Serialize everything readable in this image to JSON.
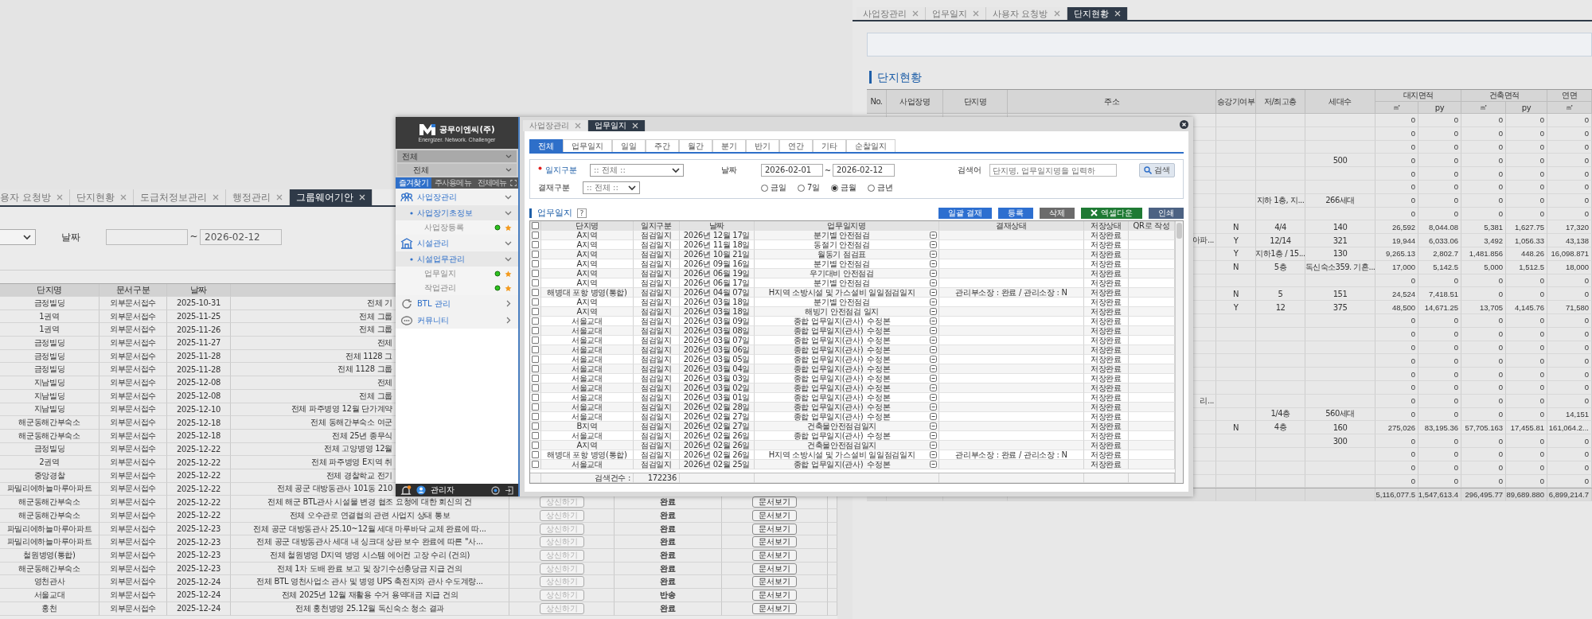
{
  "left_window": {
    "tabs": [
      {
        "label": "용자 요청방",
        "selected": false
      },
      {
        "label": "단지현황",
        "selected": false
      },
      {
        "label": "도급처정보관리",
        "selected": false
      },
      {
        "label": "행정관리",
        "selected": false
      },
      {
        "label": "그룹웨어기안",
        "selected": true
      }
    ],
    "filter": {
      "date_label": "날짜",
      "range_separator": "~",
      "date_to": "2026-02-12"
    },
    "table": {
      "columns": [
        "단지명",
        "문서구분",
        "날짜"
      ],
      "rows": [
        {
          "site": "금정빌딩",
          "doc_type": "외부문서접수",
          "date": "2025-10-31",
          "title": "전체 기"
        },
        {
          "site": "1권역",
          "doc_type": "외부문서접수",
          "date": "2025-11-25",
          "title": "전체 그룹"
        },
        {
          "site": "1권역",
          "doc_type": "외부문서접수",
          "date": "2025-11-26",
          "title": "전체 그룹"
        },
        {
          "site": "금정빌딩",
          "doc_type": "외부문서접수",
          "date": "2025-11-27",
          "title": "전체"
        },
        {
          "site": "금정빌딩",
          "doc_type": "외부문서접수",
          "date": "2025-11-28",
          "title": "전체 1128 그"
        },
        {
          "site": "금정빌딩",
          "doc_type": "외부문서접수",
          "date": "2025-11-28",
          "title": "전체 1128 그룹"
        },
        {
          "site": "지남빌딩",
          "doc_type": "외부문서접수",
          "date": "2025-12-08",
          "title": "전체"
        },
        {
          "site": "지남빌딩",
          "doc_type": "외부문서접수",
          "date": "2025-12-08",
          "title": "전체 그룹"
        },
        {
          "site": "지남빌딩",
          "doc_type": "외부문서접수",
          "date": "2025-12-10",
          "title": "전체 파주병영 12월 단가계약"
        },
        {
          "site": "해군동해간부숙소",
          "doc_type": "외부문서접수",
          "date": "2025-12-18",
          "title": "전체 동해간부숙소 여군"
        },
        {
          "site": "해군동해간부숙소",
          "doc_type": "외부문서접수",
          "date": "2025-12-18",
          "title": "전체 25년 종무식"
        },
        {
          "site": "금정빌딩",
          "doc_type": "외부문서접수",
          "date": "2025-12-22",
          "title": "전체 고양병영 12월"
        },
        {
          "site": "2권역",
          "doc_type": "외부문서접수",
          "date": "2025-12-22",
          "title": "전체 파주병영 E지역 취"
        },
        {
          "site": "중앙경찰",
          "doc_type": "외부문서접수",
          "date": "2025-12-22",
          "title": "전체 경찰학교 전기"
        },
        {
          "site": "파밀리에하늘마루아파트",
          "doc_type": "외부문서접수",
          "date": "2025-12-22",
          "title": "전체 공군 대방동관사 101동 210"
        },
        {
          "site": "해군동해간부숙소",
          "doc_type": "외부문서접수",
          "date": "2025-12-22",
          "title": "전체 해군 BTL관사 시설물 변경 협조 요청에 대한 회신의 건",
          "approve": {
            "label": "상신하기",
            "disabled": true
          },
          "status": "완료",
          "view_button": "문서보기"
        },
        {
          "site": "해군동해간부숙소",
          "doc_type": "외부문서접수",
          "date": "2025-12-22",
          "title": "전체 오수관로 연결협의 관련 사업지 상태 통보",
          "approve": {
            "label": "상신하기",
            "disabled": true
          },
          "status": "완료",
          "view_button": "문서보기"
        },
        {
          "site": "파밀리에하늘마루아파트",
          "doc_type": "외부문서접수",
          "date": "2025-12-23",
          "title": "전체 공군 대방동관사 25.10~12월 세대 마루바닥 교체 완료에 따...",
          "approve": {
            "label": "상신하기",
            "disabled": true
          },
          "status": "완료",
          "view_button": "문서보기"
        },
        {
          "site": "파밀리에하늘마루아파트",
          "doc_type": "외부문서접수",
          "date": "2025-12-23",
          "title": "전체 공군 대방동관사 세대 내 싱크대 상판 보수 완료에 따른 \"사...",
          "approve": {
            "label": "상신하기",
            "disabled": true
          },
          "status": "완료",
          "view_button": "문서보기"
        },
        {
          "site": "철원병영(통합)",
          "doc_type": "외부문서접수",
          "date": "2025-12-23",
          "title": "전체 철원병영 D지역 병영 시스템 에어컨 고장 수리 (건의)",
          "approve": {
            "label": "상신하기",
            "disabled": true
          },
          "status": "완료",
          "view_button": "문서보기"
        },
        {
          "site": "해군동해간부숙소",
          "doc_type": "외부문서접수",
          "date": "2025-12-23",
          "title": "전체 1차 도배 완료 보고 및 장기수선충당금 지급 건의",
          "approve": {
            "label": "상신하기",
            "disabled": true
          },
          "status": "완료",
          "view_button": "문서보기"
        },
        {
          "site": "영천관사",
          "doc_type": "외부문서접수",
          "date": "2025-12-24",
          "title": "전체 BTL 영천사업소 관사 및 병영 UPS 축전지와 관사 수도계량...",
          "approve": {
            "label": "상신하기",
            "disabled": true
          },
          "status": "완료",
          "view_button": "문서보기"
        },
        {
          "site": "서울교대",
          "doc_type": "외부문서접수",
          "date": "2025-12-24",
          "title": "전체 2025년 12월 재활용 수거 용역대금 지급 건의",
          "approve": {
            "label": "상신하기",
            "disabled": true
          },
          "status": "반송",
          "view_button": "문서보기"
        },
        {
          "site": "홍천",
          "doc_type": "외부문서접수",
          "date": "2025-12-24",
          "title": "전체 홍천병영 25.12월 독신숙소 청소 결과",
          "approve": {
            "label": "상신하기",
            "disabled": true
          },
          "status": "완료",
          "view_button": "문서보기"
        }
      ]
    }
  },
  "right_window": {
    "tabs": [
      {
        "label": "사업장관리",
        "selected": false
      },
      {
        "label": "업무일지",
        "selected": false
      },
      {
        "label": "사용자 요청방",
        "selected": false
      },
      {
        "label": "단지현황",
        "selected": true
      }
    ],
    "title": "단지현황",
    "table": {
      "columns": [
        {
          "label": "No."
        },
        {
          "label": "사업장명"
        },
        {
          "label": "단지명"
        },
        {
          "label": "주소"
        },
        {
          "label": "승강기여부"
        },
        {
          "label": "저/최고층"
        },
        {
          "label": "세대수"
        },
        {
          "label": "대지면적",
          "sub": [
            "㎡",
            "py"
          ]
        },
        {
          "label": "건축면적",
          "sub": [
            "㎡",
            "py"
          ]
        },
        {
          "label": "연면",
          "sub": [
            "㎡"
          ]
        }
      ],
      "rows": [
        {
          "areas": [
            "0",
            "0",
            "0",
            "0",
            "0"
          ]
        },
        {
          "areas": [
            "0",
            "0",
            "0",
            "0",
            "0"
          ]
        },
        {
          "areas": [
            "0",
            "0",
            "0",
            "0",
            "0"
          ]
        },
        {
          "households": "500",
          "areas": [
            "0",
            "0",
            "0",
            "0",
            "0"
          ]
        },
        {
          "areas": [
            "0",
            "0",
            "0",
            "0",
            "0"
          ]
        },
        {
          "areas": [
            "0",
            "0",
            "0",
            "0",
            "0"
          ]
        },
        {
          "floors": "지하 1층, 지...",
          "households": "266세대",
          "areas": [
            "0",
            "0",
            "0",
            "0",
            "0"
          ]
        },
        {
          "areas": [
            "0",
            "0",
            "0",
            "0",
            "0"
          ]
        },
        {
          "elevator": "N",
          "floors": "4/4",
          "households": "140",
          "areas": [
            "26,592",
            "8,044.08",
            "5,381",
            "1,627.75",
            "17,320"
          ]
        },
        {
          "address": "아파...",
          "elevator": "Y",
          "floors": "12/14",
          "households": "321",
          "areas": [
            "19,944",
            "6,033.06",
            "3,492",
            "1,056.33",
            "43,138"
          ]
        },
        {
          "elevator": "Y",
          "floors": "지하1층 / 15...",
          "households": "130",
          "areas": [
            "9,265.13",
            "2,802.7",
            "1,481.856",
            "448.26",
            "16,098.871"
          ]
        },
        {
          "elevator": "N",
          "floors": "5층",
          "households": "독신숙소359. 기혼...",
          "areas": [
            "17,000",
            "5,142.5",
            "5,000",
            "1,512.5",
            "18,000"
          ]
        },
        {
          "areas": [
            "0",
            "0",
            "0",
            "0",
            "0"
          ]
        },
        {
          "elevator": "N",
          "floors": "5",
          "households": "151",
          "areas": [
            "24,524",
            "7,418.51",
            "0",
            "0",
            "0"
          ]
        },
        {
          "elevator": "Y",
          "floors": "12",
          "households": "375",
          "areas": [
            "48,500",
            "14,671.25",
            "13,705",
            "4,145.76",
            "71,580"
          ]
        },
        {
          "areas": [
            "0",
            "0",
            "0",
            "0",
            "0"
          ]
        },
        {
          "areas": [
            "0",
            "0",
            "0",
            "0",
            "0"
          ]
        },
        {
          "areas": [
            "0",
            "0",
            "0",
            "0",
            "0"
          ]
        },
        {
          "areas": [
            "0",
            "0",
            "0",
            "0",
            "0"
          ]
        },
        {
          "areas": [
            "0",
            "0",
            "0",
            "0",
            "0"
          ]
        },
        {
          "areas": [
            "0",
            "0",
            "0",
            "0",
            "0"
          ]
        },
        {
          "address": "리...",
          "areas": [
            "0",
            "0",
            "0",
            "0",
            "0"
          ]
        },
        {
          "floors": "1/4층",
          "households": "560세대",
          "areas": [
            "0",
            "0",
            "0",
            "0",
            "14,151"
          ]
        },
        {
          "elevator": "N",
          "floors": "4층",
          "households": "160",
          "areas": [
            "275,026",
            "83,195.36",
            "57,705.163",
            "17,455.81",
            "161,064.2..."
          ]
        },
        {
          "households": "300",
          "areas": [
            "0",
            "0",
            "0",
            "0",
            "0"
          ]
        },
        {
          "areas": [
            "0",
            "0",
            "0",
            "0",
            "0"
          ]
        },
        {
          "areas": [
            "0",
            "0",
            "0",
            "0",
            "0"
          ]
        },
        {
          "areas": [
            "0",
            "0",
            "0",
            "0",
            "0"
          ]
        }
      ],
      "totals": [
        "5,116,077.5",
        "1,547,613.4",
        "296,495.77",
        "89,689.880",
        "6,899,214.7"
      ]
    }
  },
  "center_window": {
    "sidebar": {
      "company": "공무이엔씨(주)",
      "slogan": "Energizer. Network. Challenger",
      "selects": [
        "전체",
        "전체"
      ],
      "menu_tabs": [
        {
          "label": "즐겨찾기",
          "selected": true
        },
        {
          "label": "주사용메뉴",
          "selected": false
        },
        {
          "label": "전체메뉴",
          "selected": false
        }
      ],
      "menu": [
        {
          "label": "사업장관리",
          "expanded": true,
          "children": [
            {
              "label": "사업장기초정보",
              "expanded": true,
              "children": [
                {
                  "label": "사업장등록"
                }
              ]
            }
          ]
        },
        {
          "label": "시설관리",
          "expanded": true,
          "children": [
            {
              "label": "시설업무관리",
              "expanded": true,
              "children": [
                {
                  "label": "업무일지"
                },
                {
                  "label": "작업관리"
                }
              ]
            }
          ]
        },
        {
          "label": "BTL 관리",
          "expanded": false
        },
        {
          "label": "커뮤니티",
          "expanded": false
        }
      ],
      "user": "관리자"
    },
    "tabs": [
      {
        "label": "사업장관리",
        "selected": false
      },
      {
        "label": "업무일지",
        "selected": true
      }
    ],
    "log_tabs": [
      {
        "label": "전체",
        "selected": true
      },
      {
        "label": "업무일지",
        "selected": false
      },
      {
        "label": "일일",
        "selected": false
      },
      {
        "label": "주간",
        "selected": false
      },
      {
        "label": "월간",
        "selected": false
      },
      {
        "label": "분기",
        "selected": false
      },
      {
        "label": "반기",
        "selected": false
      },
      {
        "label": "연간",
        "selected": false
      },
      {
        "label": "기타",
        "selected": false
      },
      {
        "label": "순찰일지",
        "selected": false
      }
    ],
    "filter": {
      "type_label": "일지구분",
      "required": true,
      "type_value": ":: 전체 ::",
      "date_label": "날짜",
      "date_from": "2026-02-01",
      "range_separator": "~",
      "date_to": "2026-02-12",
      "keyword_label": "검색어",
      "keyword_placeholder": "단지명, 업무일지명을 입력하",
      "search_button": "검색",
      "approval_label": "결재구분",
      "approval_value": ":: 전체 ::",
      "periods": [
        {
          "label": "금일",
          "selected": false
        },
        {
          "label": "7일",
          "selected": false
        },
        {
          "label": "금월",
          "selected": true
        },
        {
          "label": "금년",
          "selected": false
        }
      ]
    },
    "section_title": "업무일지",
    "help": "?",
    "buttons": [
      {
        "label": "일괄 결재",
        "kind": "primary"
      },
      {
        "label": "등록",
        "kind": "primary"
      },
      {
        "label": "삭제",
        "kind": "neutral"
      },
      {
        "label": "엑셀다운",
        "kind": "excel"
      },
      {
        "label": "인쇄",
        "kind": "print"
      }
    ],
    "table": {
      "all_checked": false,
      "columns": [
        "단지명",
        "일지구분",
        "날짜",
        "업무일지명",
        "결재상태",
        "저장상태",
        "QR로 작성"
      ],
      "rows": [
        {
          "checked": false,
          "site": "A지역",
          "type": "점검일지",
          "date": "2026년 12월 17일",
          "name": "분기별 안전점검",
          "save": "저장완료"
        },
        {
          "checked": false,
          "site": "A지역",
          "type": "점검일지",
          "date": "2026년 11월 18일",
          "name": "동절기 안전점검",
          "save": "저장완료"
        },
        {
          "checked": false,
          "site": "A지역",
          "type": "점검일지",
          "date": "2026년 10월 21일",
          "name": "월동기 점검표",
          "save": "저장완료"
        },
        {
          "checked": false,
          "site": "A지역",
          "type": "점검일지",
          "date": "2026년 09월 16일",
          "name": "분기별 안전점검",
          "save": "저장완료"
        },
        {
          "checked": false,
          "site": "A지역",
          "type": "점검일지",
          "date": "2026년 06월 19일",
          "name": "우기대비 안전점검",
          "save": "저장완료"
        },
        {
          "checked": false,
          "site": "A지역",
          "type": "점검일지",
          "date": "2026년 06월 17일",
          "name": "분기별 안전점검",
          "save": "저장완료"
        },
        {
          "checked": false,
          "site": "해병대 포항 병영(통합)",
          "type": "점검일지",
          "date": "2026년 04월 07일",
          "name": "H지역 소방시설 및 가스설비 일일점검일지",
          "approval": "관리부소장 : 완료 / 관리소장 : N",
          "save": "저장완료"
        },
        {
          "checked": false,
          "site": "A지역",
          "type": "점검일지",
          "date": "2026년 03월 18일",
          "name": "분기별 안전점검",
          "save": "저장완료"
        },
        {
          "checked": false,
          "site": "A지역",
          "type": "점검일지",
          "date": "2026년 03월 18일",
          "name": "해빙기 안전점검 일지",
          "save": "저장완료"
        },
        {
          "checked": false,
          "site": "서울교대",
          "type": "점검일지",
          "date": "2026년 03월 09일",
          "name": "종합 업무일지(관사)_수정본",
          "save": "저장완료"
        },
        {
          "checked": false,
          "site": "서울교대",
          "type": "점검일지",
          "date": "2026년 03월 08일",
          "name": "종합 업무일지(관사)_수정본",
          "save": "저장완료"
        },
        {
          "checked": false,
          "site": "서울교대",
          "type": "점검일지",
          "date": "2026년 03월 07일",
          "name": "종합 업무일지(관사)_수정본",
          "save": "저장완료"
        },
        {
          "checked": false,
          "site": "서울교대",
          "type": "점검일지",
          "date": "2026년 03월 06일",
          "name": "종합 업무일지(관사)_수정본",
          "save": "저장완료"
        },
        {
          "checked": false,
          "site": "서울교대",
          "type": "점검일지",
          "date": "2026년 03월 05일",
          "name": "종합 업무일지(관사)_수정본",
          "save": "저장완료"
        },
        {
          "checked": false,
          "site": "서울교대",
          "type": "점검일지",
          "date": "2026년 03월 04일",
          "name": "종합 업무일지(관사)_수정본",
          "save": "저장완료"
        },
        {
          "checked": false,
          "site": "서울교대",
          "type": "점검일지",
          "date": "2026년 03월 03일",
          "name": "종합 업무일지(관사)_수정본",
          "save": "저장완료"
        },
        {
          "checked": false,
          "site": "서울교대",
          "type": "점검일지",
          "date": "2026년 03월 02일",
          "name": "종합 업무일지(관사)_수정본",
          "save": "저장완료"
        },
        {
          "checked": false,
          "site": "서울교대",
          "type": "점검일지",
          "date": "2026년 03월 01일",
          "name": "종합 업무일지(관사)_수정본",
          "save": "저장완료"
        },
        {
          "checked": false,
          "site": "서울교대",
          "type": "점검일지",
          "date": "2026년 02월 28일",
          "name": "종합 업무일지(관사)_수정본",
          "save": "저장완료"
        },
        {
          "checked": false,
          "site": "서울교대",
          "type": "점검일지",
          "date": "2026년 02월 27일",
          "name": "종합 업무일지(관사)_수정본",
          "save": "저장완료"
        },
        {
          "checked": false,
          "site": "B지역",
          "type": "점검일지",
          "date": "2026년 02월 27일",
          "name": "건축물안전점검일지",
          "save": "저장완료"
        },
        {
          "checked": false,
          "site": "서울교대",
          "type": "점검일지",
          "date": "2026년 02월 26일",
          "name": "종합 업무일지(관사)_수정본",
          "save": "저장완료"
        },
        {
          "checked": false,
          "site": "A지역",
          "type": "점검일지",
          "date": "2026년 02월 26일",
          "name": "건축물안전점검일지",
          "save": "저장완료"
        },
        {
          "checked": false,
          "site": "해병대 포항 병영(통합)",
          "type": "점검일지",
          "date": "2026년 02월 26일",
          "name": "H지역 소방시설 및 가스설비 일일점검일지",
          "approval": "관리부소장 : 완료 / 관리소장 : N",
          "save": "저장완료"
        },
        {
          "checked": false,
          "site": "서울교대",
          "type": "점검일지",
          "date": "2026년 02월 25일",
          "name": "종합 업무일지(관사)_수정본",
          "save": "저장완료"
        }
      ],
      "count_label": "검색건수 :",
      "count": "172236"
    }
  }
}
